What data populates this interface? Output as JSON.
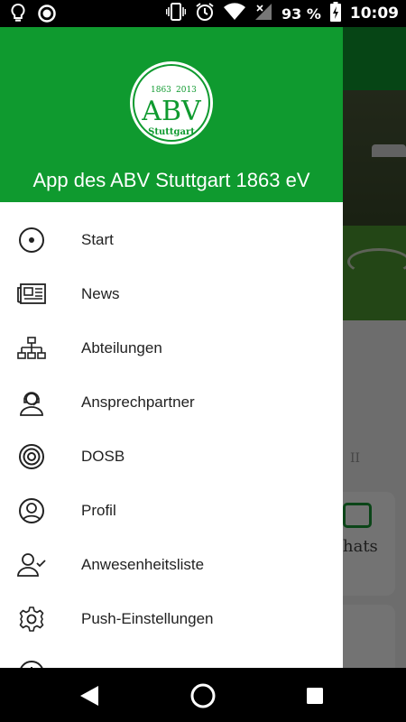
{
  "status_bar": {
    "left_icons": [
      "bulb-icon",
      "record-icon"
    ],
    "right_icons": [
      "vibrate-icon",
      "alarm-icon",
      "wifi-icon",
      "signal-icon",
      "battery-charging-icon"
    ],
    "battery": "93 %",
    "time": "10:09"
  },
  "drawer": {
    "logo": {
      "top_left": "1863",
      "top_right": "2013",
      "letters": "ABV",
      "bottom": "Stuttgart"
    },
    "title": "App des ABV Stuttgart 1863 eV",
    "items": [
      {
        "label": "Start",
        "icon": "start-icon"
      },
      {
        "label": "News",
        "icon": "newspaper-icon"
      },
      {
        "label": "Abteilungen",
        "icon": "org-chart-icon"
      },
      {
        "label": "Ansprechpartner",
        "icon": "headset-icon"
      },
      {
        "label": "DOSB",
        "icon": "target-icon"
      },
      {
        "label": "Profil",
        "icon": "profile-icon"
      },
      {
        "label": "Anwesenheitsliste",
        "icon": "user-check-icon"
      },
      {
        "label": "Push-Einstellungen",
        "icon": "gear-icon"
      }
    ]
  },
  "background": {
    "small_text": "II",
    "card_label": "hats"
  },
  "nav_bar": {
    "buttons": [
      "back-icon",
      "home-icon",
      "recents-icon"
    ]
  },
  "colors": {
    "brand_green": "#0f9a2f"
  }
}
